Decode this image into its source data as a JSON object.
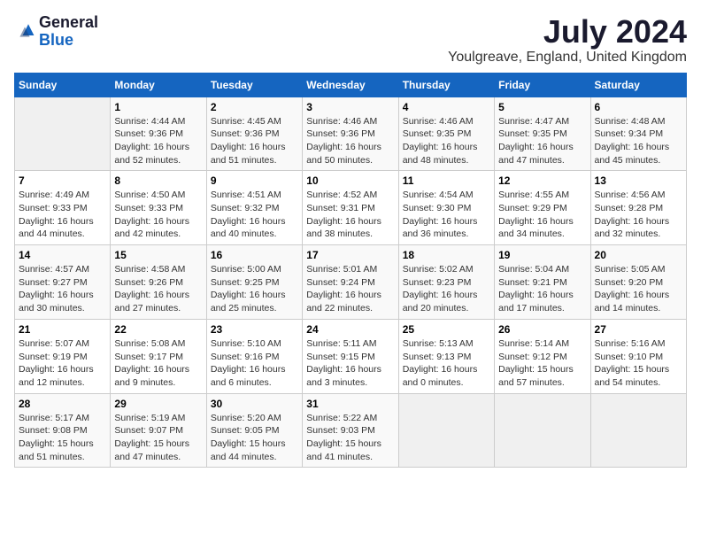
{
  "header": {
    "logo_general": "General",
    "logo_blue": "Blue",
    "month_title": "July 2024",
    "location": "Youlgreave, England, United Kingdom"
  },
  "weekdays": [
    "Sunday",
    "Monday",
    "Tuesday",
    "Wednesday",
    "Thursday",
    "Friday",
    "Saturday"
  ],
  "weeks": [
    [
      {
        "day": "",
        "info": ""
      },
      {
        "day": "1",
        "info": "Sunrise: 4:44 AM\nSunset: 9:36 PM\nDaylight: 16 hours\nand 52 minutes."
      },
      {
        "day": "2",
        "info": "Sunrise: 4:45 AM\nSunset: 9:36 PM\nDaylight: 16 hours\nand 51 minutes."
      },
      {
        "day": "3",
        "info": "Sunrise: 4:46 AM\nSunset: 9:36 PM\nDaylight: 16 hours\nand 50 minutes."
      },
      {
        "day": "4",
        "info": "Sunrise: 4:46 AM\nSunset: 9:35 PM\nDaylight: 16 hours\nand 48 minutes."
      },
      {
        "day": "5",
        "info": "Sunrise: 4:47 AM\nSunset: 9:35 PM\nDaylight: 16 hours\nand 47 minutes."
      },
      {
        "day": "6",
        "info": "Sunrise: 4:48 AM\nSunset: 9:34 PM\nDaylight: 16 hours\nand 45 minutes."
      }
    ],
    [
      {
        "day": "7",
        "info": "Sunrise: 4:49 AM\nSunset: 9:33 PM\nDaylight: 16 hours\nand 44 minutes."
      },
      {
        "day": "8",
        "info": "Sunrise: 4:50 AM\nSunset: 9:33 PM\nDaylight: 16 hours\nand 42 minutes."
      },
      {
        "day": "9",
        "info": "Sunrise: 4:51 AM\nSunset: 9:32 PM\nDaylight: 16 hours\nand 40 minutes."
      },
      {
        "day": "10",
        "info": "Sunrise: 4:52 AM\nSunset: 9:31 PM\nDaylight: 16 hours\nand 38 minutes."
      },
      {
        "day": "11",
        "info": "Sunrise: 4:54 AM\nSunset: 9:30 PM\nDaylight: 16 hours\nand 36 minutes."
      },
      {
        "day": "12",
        "info": "Sunrise: 4:55 AM\nSunset: 9:29 PM\nDaylight: 16 hours\nand 34 minutes."
      },
      {
        "day": "13",
        "info": "Sunrise: 4:56 AM\nSunset: 9:28 PM\nDaylight: 16 hours\nand 32 minutes."
      }
    ],
    [
      {
        "day": "14",
        "info": "Sunrise: 4:57 AM\nSunset: 9:27 PM\nDaylight: 16 hours\nand 30 minutes."
      },
      {
        "day": "15",
        "info": "Sunrise: 4:58 AM\nSunset: 9:26 PM\nDaylight: 16 hours\nand 27 minutes."
      },
      {
        "day": "16",
        "info": "Sunrise: 5:00 AM\nSunset: 9:25 PM\nDaylight: 16 hours\nand 25 minutes."
      },
      {
        "day": "17",
        "info": "Sunrise: 5:01 AM\nSunset: 9:24 PM\nDaylight: 16 hours\nand 22 minutes."
      },
      {
        "day": "18",
        "info": "Sunrise: 5:02 AM\nSunset: 9:23 PM\nDaylight: 16 hours\nand 20 minutes."
      },
      {
        "day": "19",
        "info": "Sunrise: 5:04 AM\nSunset: 9:21 PM\nDaylight: 16 hours\nand 17 minutes."
      },
      {
        "day": "20",
        "info": "Sunrise: 5:05 AM\nSunset: 9:20 PM\nDaylight: 16 hours\nand 14 minutes."
      }
    ],
    [
      {
        "day": "21",
        "info": "Sunrise: 5:07 AM\nSunset: 9:19 PM\nDaylight: 16 hours\nand 12 minutes."
      },
      {
        "day": "22",
        "info": "Sunrise: 5:08 AM\nSunset: 9:17 PM\nDaylight: 16 hours\nand 9 minutes."
      },
      {
        "day": "23",
        "info": "Sunrise: 5:10 AM\nSunset: 9:16 PM\nDaylight: 16 hours\nand 6 minutes."
      },
      {
        "day": "24",
        "info": "Sunrise: 5:11 AM\nSunset: 9:15 PM\nDaylight: 16 hours\nand 3 minutes."
      },
      {
        "day": "25",
        "info": "Sunrise: 5:13 AM\nSunset: 9:13 PM\nDaylight: 16 hours\nand 0 minutes."
      },
      {
        "day": "26",
        "info": "Sunrise: 5:14 AM\nSunset: 9:12 PM\nDaylight: 15 hours\nand 57 minutes."
      },
      {
        "day": "27",
        "info": "Sunrise: 5:16 AM\nSunset: 9:10 PM\nDaylight: 15 hours\nand 54 minutes."
      }
    ],
    [
      {
        "day": "28",
        "info": "Sunrise: 5:17 AM\nSunset: 9:08 PM\nDaylight: 15 hours\nand 51 minutes."
      },
      {
        "day": "29",
        "info": "Sunrise: 5:19 AM\nSunset: 9:07 PM\nDaylight: 15 hours\nand 47 minutes."
      },
      {
        "day": "30",
        "info": "Sunrise: 5:20 AM\nSunset: 9:05 PM\nDaylight: 15 hours\nand 44 minutes."
      },
      {
        "day": "31",
        "info": "Sunrise: 5:22 AM\nSunset: 9:03 PM\nDaylight: 15 hours\nand 41 minutes."
      },
      {
        "day": "",
        "info": ""
      },
      {
        "day": "",
        "info": ""
      },
      {
        "day": "",
        "info": ""
      }
    ]
  ]
}
